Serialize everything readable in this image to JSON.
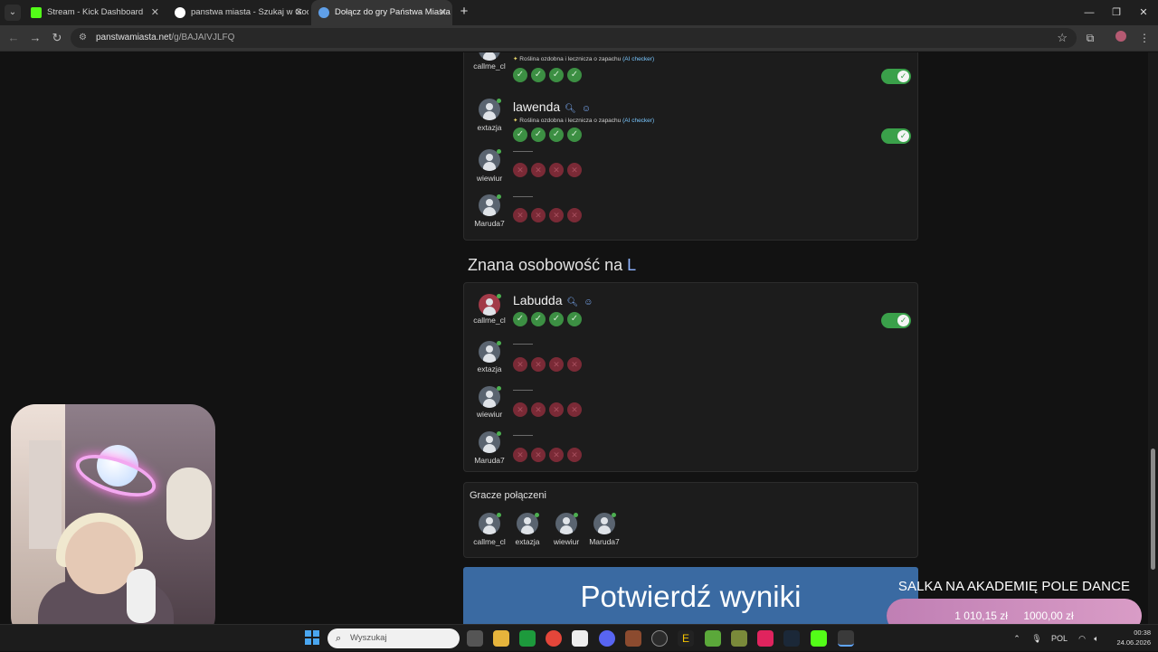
{
  "browser": {
    "tabs": [
      {
        "title": "Stream - Kick Dashboard",
        "active": false
      },
      {
        "title": "panstwa miasta - Szukaj w Goo",
        "active": false
      },
      {
        "title": "Dołącz do gry Państwa Miasta",
        "active": true
      }
    ],
    "url_domain": "panstwamiasta.net",
    "url_path": "/g/BAJAIVJLFQ"
  },
  "game": {
    "category1": {
      "rows": [
        {
          "player": "callme_cl",
          "answer": "",
          "hint": "Roślina ozdobna i lecznicza o zapachu",
          "ai_label": "(AI checker)",
          "votes": [
            "ok",
            "ok",
            "ok",
            "ok"
          ],
          "accepted": true,
          "partial": true
        },
        {
          "player": "extazja",
          "answer": "lawenda",
          "hint": "Roślina ozdobna i lecznicza o zapachu",
          "ai_label": "(AI checker)",
          "votes": [
            "ok",
            "ok",
            "ok",
            "ok"
          ],
          "accepted": true
        },
        {
          "player": "wiewiur",
          "answer": "",
          "votes": [
            "no",
            "no",
            "no",
            "no"
          ],
          "accepted": false
        },
        {
          "player": "Maruda7",
          "answer": "",
          "votes": [
            "no",
            "no",
            "no",
            "no"
          ],
          "accepted": false
        }
      ]
    },
    "category2": {
      "title_prefix": "Znana osobowość na",
      "letter": "L",
      "rows": [
        {
          "player": "callme_cl",
          "answer": "Labudda",
          "votes": [
            "ok",
            "ok",
            "ok",
            "ok"
          ],
          "accepted": true
        },
        {
          "player": "extazja",
          "answer": "",
          "votes": [
            "no",
            "no",
            "no",
            "no"
          ],
          "accepted": false
        },
        {
          "player": "wiewiur",
          "answer": "",
          "votes": [
            "no",
            "no",
            "no",
            "no"
          ],
          "accepted": false
        },
        {
          "player": "Maruda7",
          "answer": "",
          "votes": [
            "no",
            "no",
            "no",
            "no"
          ],
          "accepted": false
        }
      ]
    },
    "connected": {
      "title": "Gracze połączeni",
      "players": [
        "callme_cl",
        "extazja",
        "wiewiur",
        "Maruda7"
      ]
    },
    "confirm_label": "Potwierdź wyniki"
  },
  "overlay": {
    "promo_title": "SALKA NA AKADEMIĘ POLE DANCE",
    "raised": "1 010,15 zł",
    "goal": "1000,00 zł",
    "progress": 1.0
  },
  "taskbar": {
    "search_placeholder": "Wyszukaj",
    "language": "POL",
    "time": "00:38",
    "date": "24.06.2026"
  },
  "colors": {
    "accent_blue": "#3a6aa2",
    "ok_green": "#3c8f43",
    "reject_red": "#7a2a36",
    "toggle_on": "#3aa04a",
    "promo_pink": "#b47aa6"
  }
}
